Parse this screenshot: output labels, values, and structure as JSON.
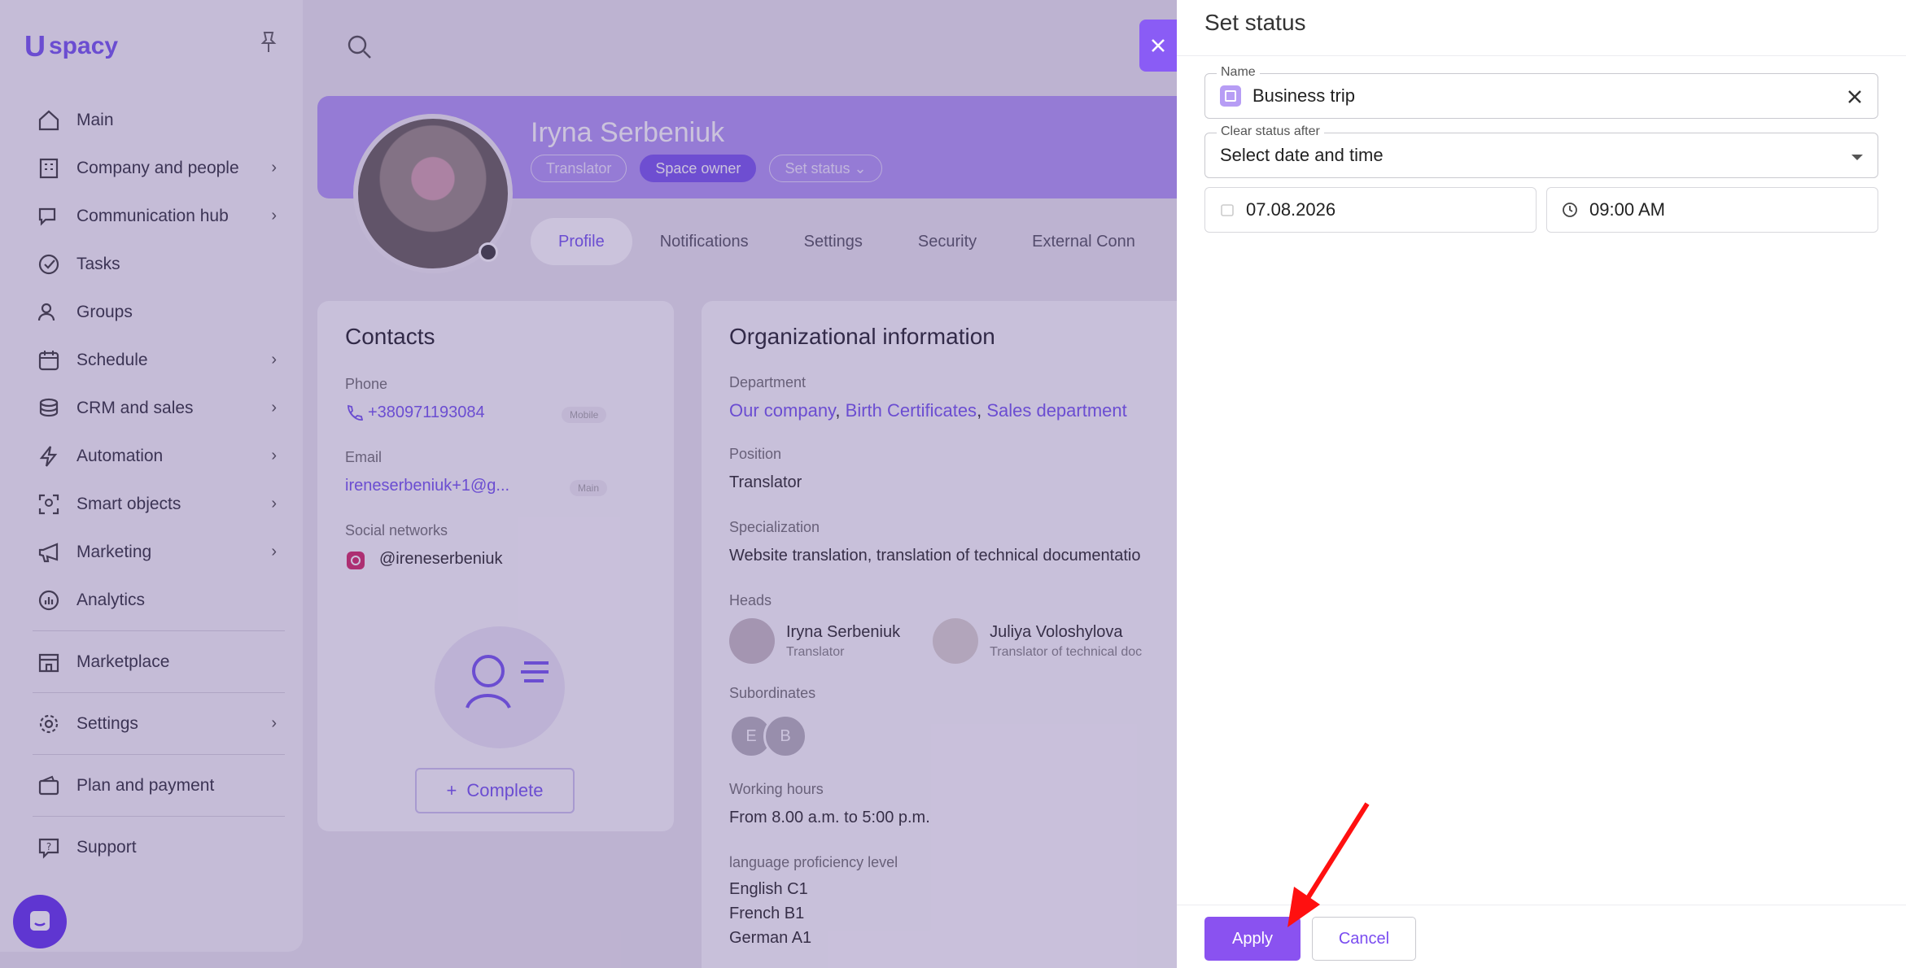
{
  "sidebar": {
    "logo_mark": "U",
    "logo_text": "spacy",
    "items": [
      {
        "label": "Main",
        "icon": "home-icon",
        "chevron": false
      },
      {
        "label": "Company and people",
        "icon": "building-icon",
        "chevron": true
      },
      {
        "label": "Communication hub",
        "icon": "chat-icon",
        "chevron": true
      },
      {
        "label": "Tasks",
        "icon": "check-circle-icon",
        "chevron": false
      },
      {
        "label": "Groups",
        "icon": "users-icon",
        "chevron": false
      },
      {
        "label": "Schedule",
        "icon": "calendar-icon",
        "chevron": true
      },
      {
        "label": "CRM and sales",
        "icon": "coins-icon",
        "chevron": true
      },
      {
        "label": "Automation",
        "icon": "lightning-icon",
        "chevron": true
      },
      {
        "label": "Smart objects",
        "icon": "scan-icon",
        "chevron": true
      },
      {
        "label": "Marketing",
        "icon": "megaphone-icon",
        "chevron": true
      },
      {
        "label": "Analytics",
        "icon": "chart-icon",
        "chevron": false
      }
    ],
    "marketplace": "Marketplace",
    "settings": "Settings",
    "plan": "Plan and payment",
    "support": "Support",
    "chevron_glyph": "›"
  },
  "profile": {
    "name": "Iryna Serbeniuk",
    "badge_role": "Translator",
    "badge_owner": "Space owner",
    "badge_status": "Set status ⌄",
    "tabs": [
      "Profile",
      "Notifications",
      "Settings",
      "Security",
      "External Conn"
    ]
  },
  "contacts": {
    "title": "Contacts",
    "phone_label": "Phone",
    "phone": "+380971193084",
    "phone_tag": "Mobile",
    "email_label": "Email",
    "email": "ireneserbeniuk+1@g...",
    "email_tag": "Main",
    "social_label": "Social networks",
    "social": "@ireneserbeniuk",
    "complete_plus": "+",
    "complete": "Complete"
  },
  "org": {
    "title": "Organizational information",
    "department_label": "Department",
    "dept_1": "Our company",
    "dept_2": "Birth Certificates",
    "dept_3": "Sales department",
    "dept_sep": ",",
    "position_label": "Position",
    "position": "Translator",
    "specialization_label": "Specialization",
    "specialization": "Website translation, translation of technical documentatio",
    "heads_label": "Heads",
    "heads": [
      {
        "name": "Iryna Serbeniuk",
        "role": "Translator"
      },
      {
        "name": "Juliya Voloshylova",
        "role": "Translator of technical doc"
      }
    ],
    "subordinates_label": "Subordinates",
    "subordinates": [
      "E",
      "B"
    ],
    "working_hours_label": "Working hours",
    "working_hours": "From 8.00 a.m. to 5:00 p.m.",
    "language_label": "language proficiency level",
    "languages": [
      "English C1",
      "French B1",
      "German A1"
    ]
  },
  "panel": {
    "title": "Set status",
    "name_legend": "Name",
    "name_value": "Business trip",
    "clear_legend": "Clear status after",
    "clear_value": "Select date and time",
    "date_value": "07.08.2026",
    "time_value": "09:00 AM",
    "apply": "Apply",
    "cancel": "Cancel"
  },
  "colors": {
    "accent": "#8a52f0",
    "overlay": "#7a5cf0"
  }
}
